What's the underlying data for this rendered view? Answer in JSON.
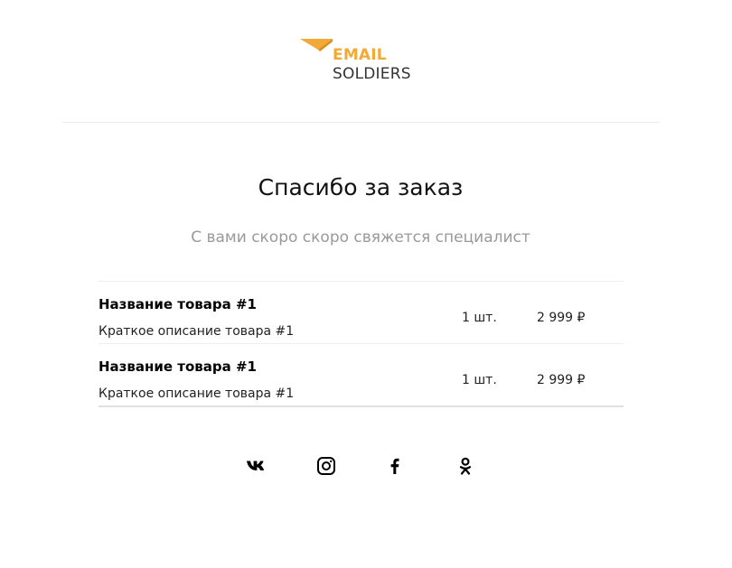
{
  "logo": {
    "line1": "EMAIL",
    "line2": "SOLDIERS",
    "accent_color": "#f3a935",
    "text_color": "#333333"
  },
  "heading": {
    "title": "Спасибо за заказ",
    "subtitle": "С вами скоро скоро свяжется специалист"
  },
  "order_items": [
    {
      "name": "Название товара #1",
      "description": "Краткое описание товара #1",
      "quantity": "1 шт.",
      "price": "2 999 ₽"
    },
    {
      "name": "Название товара #1",
      "description": "Краткое описание товара #1",
      "quantity": "1 шт.",
      "price": "2 999 ₽"
    }
  ],
  "social_links": [
    {
      "network": "vk",
      "icon": "vk-icon"
    },
    {
      "network": "instagram",
      "icon": "instagram-icon"
    },
    {
      "network": "facebook",
      "icon": "facebook-icon"
    },
    {
      "network": "odnoklassniki",
      "icon": "odnoklassniki-icon"
    }
  ]
}
